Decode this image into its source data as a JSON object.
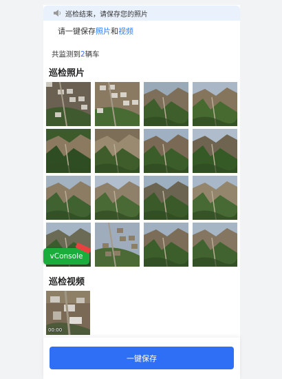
{
  "notice": {
    "text": "巡检结束，请保存您的照片"
  },
  "hint": {
    "prefix": "请一键保存",
    "link_photos": "照片",
    "and": "和",
    "link_videos": "视频"
  },
  "count": {
    "prefix": "共监测到",
    "number": "2",
    "suffix": "辆车"
  },
  "photos_section": {
    "title": "巡检照片",
    "thumbnails": [
      {
        "label": "village-aerial"
      },
      {
        "label": "road-village-aerial"
      },
      {
        "label": "mountain-valley"
      },
      {
        "label": "mountain-ridge"
      },
      {
        "label": "forest-slope"
      },
      {
        "label": "bare-slope"
      },
      {
        "label": "mountain-valley"
      },
      {
        "label": "forest-ridge"
      },
      {
        "label": "valley-road"
      },
      {
        "label": "hillside"
      },
      {
        "label": "mountain-slope"
      },
      {
        "label": "hill-houses"
      },
      {
        "label": "forest-path"
      },
      {
        "label": "village-slope"
      },
      {
        "label": "village-valley"
      },
      {
        "label": "mountain-valley"
      }
    ]
  },
  "videos_section": {
    "title": "巡检视频",
    "duration": "00:00"
  },
  "vconsole": {
    "label": "vConsole"
  },
  "actions": {
    "save_label": "一键保存"
  },
  "colors": {
    "accent": "#2f6ff6",
    "link": "#2f7cf6",
    "vconsole": "#1aad3c"
  }
}
